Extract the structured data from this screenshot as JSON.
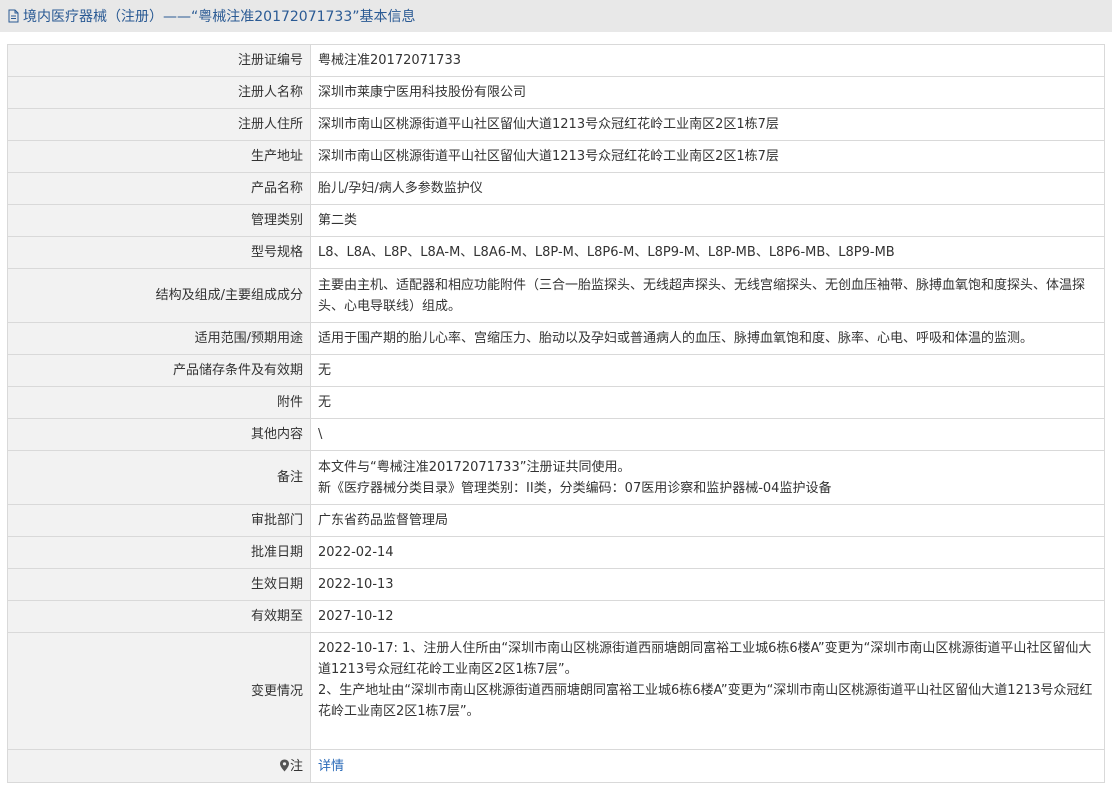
{
  "header": {
    "title": "境内医疗器械（注册）——“粤械注准20172071733”基本信息",
    "icon": "document-icon"
  },
  "rows": [
    {
      "label": "注册证编号",
      "value": "粤械注准20172071733"
    },
    {
      "label": "注册人名称",
      "value": "深圳市莱康宁医用科技股份有限公司"
    },
    {
      "label": "注册人住所",
      "value": "深圳市南山区桃源街道平山社区留仙大道1213号众冠红花岭工业南区2区1栋7层"
    },
    {
      "label": "生产地址",
      "value": "深圳市南山区桃源街道平山社区留仙大道1213号众冠红花岭工业南区2区1栋7层"
    },
    {
      "label": "产品名称",
      "value": "胎儿/孕妇/病人多参数监护仪"
    },
    {
      "label": "管理类别",
      "value": "第二类"
    },
    {
      "label": "型号规格",
      "value": "L8、L8A、L8P、L8A-M、L8A6-M、L8P-M、L8P6-M、L8P9-M、L8P-MB、L8P6-MB、L8P9-MB"
    },
    {
      "label": "结构及组成/主要组成成分",
      "value": "主要由主机、适配器和相应功能附件（三合一胎监探头、无线超声探头、无线宫缩探头、无创血压袖带、脉搏血氧饱和度探头、体温探头、心电导联线）组成。"
    },
    {
      "label": "适用范围/预期用途",
      "value": "适用于围产期的胎儿心率、宫缩压力、胎动以及孕妇或普通病人的血压、脉搏血氧饱和度、脉率、心电、呼吸和体温的监测。"
    },
    {
      "label": "产品储存条件及有效期",
      "value": "无"
    },
    {
      "label": "附件",
      "value": "无"
    },
    {
      "label": "其他内容",
      "value": "\\"
    },
    {
      "label": "备注",
      "lines": [
        "本文件与“粤械注准20172071733”注册证共同使用。",
        "新《医疗器械分类目录》管理类别：II类，分类编码：07医用诊察和监护器械-04监护设备"
      ]
    },
    {
      "label": "审批部门",
      "value": "广东省药品监督管理局"
    },
    {
      "label": "批准日期",
      "value": "2022-02-14"
    },
    {
      "label": "生效日期",
      "value": "2022-10-13"
    },
    {
      "label": "有效期至",
      "value": "2027-10-12"
    },
    {
      "label": "变更情况",
      "lines": [
        "2022-10-17: 1、注册人住所由“深圳市南山区桃源街道西丽塘朗同富裕工业城6栋6楼A”变更为“深圳市南山区桃源街道平山社区留仙大道1213号众冠红花岭工业南区2区1栋7层”。",
        "2、生产地址由“深圳市南山区桃源街道西丽塘朗同富裕工业城6栋6楼A”变更为“深圳市南山区桃源街道平山社区留仙大道1213号众冠红花岭工业南区2区1栋7层”。"
      ]
    }
  ],
  "note": {
    "label": "注",
    "icon": "location-pin-icon",
    "link_text": "详情"
  },
  "colors": {
    "title_text": "#2a5a94",
    "link": "#2a6ab8",
    "label_bg": "#f2f2f2",
    "border": "#d9d9d9"
  }
}
